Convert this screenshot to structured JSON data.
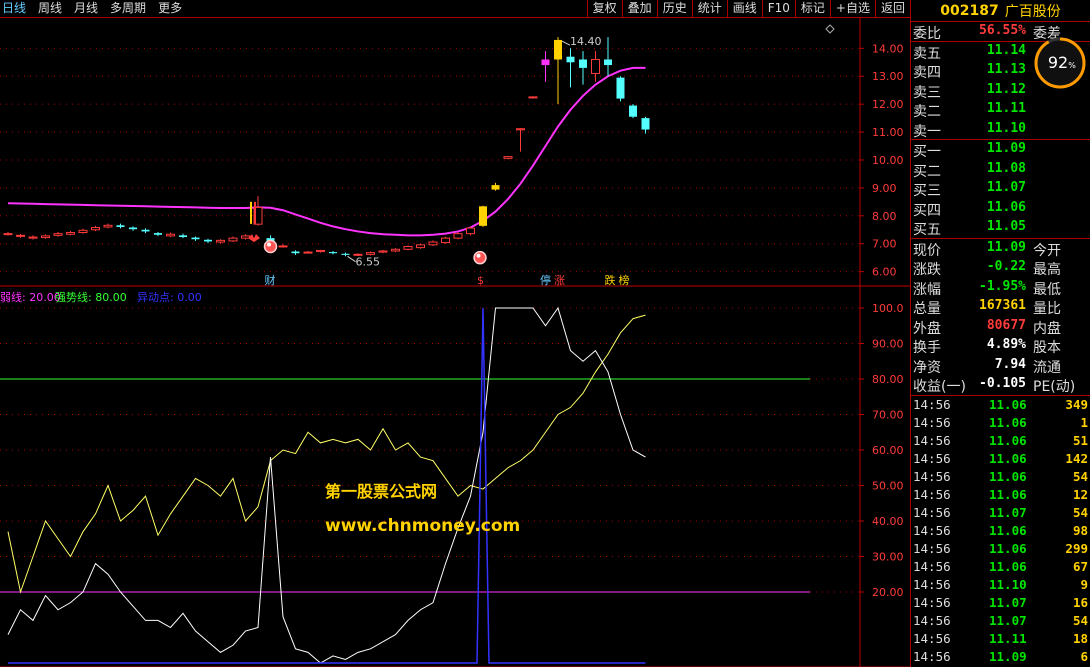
{
  "toolbar": {
    "periods": [
      {
        "label": "日线",
        "active": true
      },
      {
        "label": "周线",
        "active": false
      },
      {
        "label": "月线",
        "active": false
      },
      {
        "label": "多周期",
        "active": false
      },
      {
        "label": "更多",
        "active": false
      }
    ],
    "tools": [
      "复权",
      "叠加",
      "历史",
      "统计",
      "画线",
      "F10",
      "标记",
      "+自选",
      "返回"
    ]
  },
  "chart_data": [
    {
      "type": "candlestick",
      "y_ticks": [
        "14.00",
        "13.00",
        "12.00",
        "11.00",
        "10.00",
        "9.00",
        "8.00",
        "7.00",
        "6.00"
      ],
      "ylim": [
        5.7,
        14.8
      ],
      "high_label": "14.40",
      "low_label": "6.55",
      "markers": [
        "财",
        "$",
        "停",
        "涨",
        "跌",
        "榜"
      ],
      "candles": [
        {
          "o": 7.36,
          "c": 7.36,
          "h": 7.42,
          "l": 7.3
        },
        {
          "o": 7.3,
          "c": 7.3,
          "h": 7.35,
          "l": 7.22
        },
        {
          "o": 7.2,
          "c": 7.24,
          "h": 7.3,
          "l": 7.15
        },
        {
          "o": 7.22,
          "c": 7.28,
          "h": 7.33,
          "l": 7.18
        },
        {
          "o": 7.3,
          "c": 7.36,
          "h": 7.42,
          "l": 7.25
        },
        {
          "o": 7.34,
          "c": 7.4,
          "h": 7.46,
          "l": 7.3
        },
        {
          "o": 7.4,
          "c": 7.48,
          "h": 7.54,
          "l": 7.36
        },
        {
          "o": 7.5,
          "c": 7.58,
          "h": 7.64,
          "l": 7.45
        },
        {
          "o": 7.6,
          "c": 7.66,
          "h": 7.72,
          "l": 7.55
        },
        {
          "o": 7.66,
          "c": 7.6,
          "h": 7.72,
          "l": 7.55
        },
        {
          "o": 7.58,
          "c": 7.52,
          "h": 7.62,
          "l": 7.46
        },
        {
          "o": 7.5,
          "c": 7.44,
          "h": 7.55,
          "l": 7.38
        },
        {
          "o": 7.38,
          "c": 7.32,
          "h": 7.42,
          "l": 7.27
        },
        {
          "o": 7.28,
          "c": 7.34,
          "h": 7.4,
          "l": 7.24
        },
        {
          "o": 7.3,
          "c": 7.24,
          "h": 7.36,
          "l": 7.2
        },
        {
          "o": 7.22,
          "c": 7.16,
          "h": 7.26,
          "l": 7.1
        },
        {
          "o": 7.14,
          "c": 7.08,
          "h": 7.18,
          "l": 7.02
        },
        {
          "o": 7.06,
          "c": 7.12,
          "h": 7.16,
          "l": 7.0
        },
        {
          "o": 7.1,
          "c": 7.2,
          "h": 7.26,
          "l": 7.06
        },
        {
          "o": 7.2,
          "c": 7.28,
          "h": 7.34,
          "l": 7.15
        },
        {
          "o": 7.7,
          "c": 8.3,
          "h": 8.7,
          "l": 7.65
        },
        {
          "o": 7.2,
          "c": 7.1,
          "h": 7.3,
          "l": 6.8
        },
        {
          "o": 6.92,
          "c": 6.92,
          "h": 6.98,
          "l": 6.86
        },
        {
          "o": 6.72,
          "c": 6.66,
          "h": 6.76,
          "l": 6.6
        },
        {
          "o": 6.7,
          "c": 6.7,
          "h": 6.74,
          "l": 6.66
        },
        {
          "o": 6.72,
          "c": 6.76,
          "h": 6.78,
          "l": 6.68
        },
        {
          "o": 6.7,
          "c": 6.66,
          "h": 6.74,
          "l": 6.62
        },
        {
          "o": 6.64,
          "c": 6.6,
          "h": 6.68,
          "l": 6.55
        },
        {
          "o": 6.6,
          "c": 6.62,
          "h": 6.66,
          "l": 6.56
        },
        {
          "o": 6.62,
          "c": 6.68,
          "h": 6.72,
          "l": 6.58
        },
        {
          "o": 6.7,
          "c": 6.74,
          "h": 6.78,
          "l": 6.66
        },
        {
          "o": 6.74,
          "c": 6.8,
          "h": 6.84,
          "l": 6.7
        },
        {
          "o": 6.8,
          "c": 6.9,
          "h": 6.94,
          "l": 6.76
        },
        {
          "o": 6.86,
          "c": 6.96,
          "h": 7.0,
          "l": 6.82
        },
        {
          "o": 6.96,
          "c": 7.06,
          "h": 7.12,
          "l": 6.92
        },
        {
          "o": 7.04,
          "c": 7.2,
          "h": 7.24,
          "l": 7.0
        },
        {
          "o": 7.2,
          "c": 7.36,
          "h": 7.4,
          "l": 7.16
        },
        {
          "o": 7.36,
          "c": 7.56,
          "h": 7.6,
          "l": 7.3
        },
        {
          "o": 7.64,
          "c": 8.34,
          "h": 8.36,
          "l": 7.6
        },
        {
          "o": 8.94,
          "c": 9.1,
          "h": 9.18,
          "l": 8.9
        },
        {
          "o": 10.06,
          "c": 10.12,
          "h": 10.14,
          "l": 10.02
        },
        {
          "o": 11.08,
          "c": 11.12,
          "h": 11.14,
          "l": 10.3
        },
        {
          "o": 12.24,
          "c": 12.26,
          "h": 12.28,
          "l": 12.2
        },
        {
          "o": 13.4,
          "c": 13.6,
          "h": 13.9,
          "l": 12.8
        },
        {
          "o": 13.6,
          "c": 14.3,
          "h": 14.4,
          "l": 12.0
        },
        {
          "o": 13.7,
          "c": 13.5,
          "h": 14.0,
          "l": 12.6
        },
        {
          "o": 13.6,
          "c": 13.3,
          "h": 13.9,
          "l": 12.7
        },
        {
          "o": 13.1,
          "c": 13.6,
          "h": 13.9,
          "l": 12.8
        },
        {
          "o": 13.6,
          "c": 13.4,
          "h": 14.4,
          "l": 13.0
        },
        {
          "o": 12.95,
          "c": 12.2,
          "h": 13.0,
          "l": 12.1
        },
        {
          "o": 11.95,
          "c": 11.55,
          "h": 12.0,
          "l": 11.5
        },
        {
          "o": 11.5,
          "c": 11.09,
          "h": 11.55,
          "l": 10.95
        }
      ],
      "ma": [
        8.45,
        8.44,
        8.43,
        8.42,
        8.41,
        8.4,
        8.39,
        8.38,
        8.37,
        8.36,
        8.35,
        8.34,
        8.33,
        8.32,
        8.31,
        8.3,
        8.29,
        8.28,
        8.28,
        8.28,
        8.3,
        8.29,
        8.2,
        8.05,
        7.9,
        7.75,
        7.62,
        7.52,
        7.44,
        7.38,
        7.34,
        7.32,
        7.3,
        7.3,
        7.32,
        7.36,
        7.44,
        7.58,
        7.82,
        8.15,
        8.6,
        9.15,
        9.8,
        10.5,
        11.2,
        11.8,
        12.3,
        12.7,
        13.0,
        13.2,
        13.3,
        13.3
      ]
    },
    {
      "type": "line",
      "legend": [
        {
          "label": "弱线: 20.00",
          "color": "#ff33ff"
        },
        {
          "label": "强势线: 80.00",
          "color": "#33ff33"
        },
        {
          "label": "异动点: 0.00",
          "color": "#3333ff"
        }
      ],
      "y_ticks": [
        "100.0",
        "90.00",
        "80.00",
        "70.00",
        "60.00",
        "50.00",
        "40.00",
        "30.00",
        "20.00"
      ],
      "ylim": [
        0,
        100
      ],
      "reference_lines": [
        20,
        80
      ],
      "series": [
        {
          "values": [
            37,
            20,
            30,
            40,
            35,
            30,
            37,
            42,
            50,
            40,
            43,
            47,
            36,
            42,
            47,
            52,
            50,
            47,
            52,
            40,
            44,
            57,
            60,
            59,
            65,
            62,
            63,
            62,
            63,
            60,
            66,
            60,
            62,
            58,
            57,
            52,
            47,
            50,
            49,
            52,
            55,
            57,
            60,
            65,
            70,
            72,
            76,
            82,
            87,
            93,
            97,
            98
          ]
        },
        {
          "values": [
            8,
            15,
            12,
            19,
            15,
            17,
            20,
            28,
            25,
            20,
            16,
            12,
            12,
            10,
            14,
            9,
            6,
            3,
            5,
            9,
            10,
            58,
            13,
            4,
            3,
            0,
            2,
            1,
            3,
            4,
            6,
            8,
            12,
            15,
            17,
            28,
            38,
            47,
            65,
            100,
            100,
            100,
            100,
            95,
            100,
            88,
            85,
            88,
            82,
            70,
            60,
            58
          ]
        },
        {
          "values": [
            0,
            0,
            0,
            0,
            0,
            0,
            0,
            0,
            0,
            0,
            0,
            0,
            0,
            0,
            0,
            0,
            0,
            0,
            0,
            0,
            0,
            0,
            0,
            0,
            0,
            0,
            0,
            0,
            0,
            0,
            0,
            0,
            0,
            0,
            0,
            0,
            0,
            0,
            100,
            0,
            0,
            0,
            0,
            0,
            0,
            0,
            0,
            0,
            0,
            0,
            0,
            0
          ]
        }
      ]
    }
  ],
  "watermark": {
    "line1": "第一股票公式网",
    "line2": "www.chnmoney.com"
  },
  "quote": {
    "code": "002187",
    "name": "广百股份",
    "weibi": {
      "label": "委比",
      "value": "56.55%",
      "label2": "委差"
    },
    "gauge_value": "92",
    "gauge_unit": "%",
    "gauge_fraction": 0.92,
    "asks": [
      {
        "label": "卖五",
        "price": "11.14"
      },
      {
        "label": "卖四",
        "price": "11.13"
      },
      {
        "label": "卖三",
        "price": "11.12"
      },
      {
        "label": "卖二",
        "price": "11.11"
      },
      {
        "label": "卖一",
        "price": "11.10"
      }
    ],
    "bids": [
      {
        "label": "买一",
        "price": "11.09"
      },
      {
        "label": "买二",
        "price": "11.08"
      },
      {
        "label": "买三",
        "price": "11.07"
      },
      {
        "label": "买四",
        "price": "11.06"
      },
      {
        "label": "买五",
        "price": "11.05"
      }
    ],
    "stats": [
      {
        "label": "现价",
        "value": "11.09",
        "label2": "今开",
        "color": "green"
      },
      {
        "label": "涨跌",
        "value": "-0.22",
        "label2": "最高",
        "color": "green"
      },
      {
        "label": "涨幅",
        "value": "-1.95%",
        "label2": "最低",
        "color": "green"
      },
      {
        "label": "总量",
        "value": "167361",
        "label2": "量比",
        "color": "yellow"
      },
      {
        "label": "外盘",
        "value": "80677",
        "label2": "内盘",
        "color": "red"
      },
      {
        "label": "换手",
        "value": "4.89%",
        "label2": "股本",
        "color": "white"
      },
      {
        "label": "净资",
        "value": "7.94",
        "label2": "流通",
        "color": "white"
      },
      {
        "label": "收益(一)",
        "value": "-0.105",
        "label2": "PE(动)",
        "color": "white"
      }
    ],
    "ticks": [
      {
        "time": "14:56",
        "price": "11.06",
        "vol": "349"
      },
      {
        "time": "14:56",
        "price": "11.06",
        "vol": "1"
      },
      {
        "time": "14:56",
        "price": "11.06",
        "vol": "51"
      },
      {
        "time": "14:56",
        "price": "11.06",
        "vol": "142"
      },
      {
        "time": "14:56",
        "price": "11.06",
        "vol": "54"
      },
      {
        "time": "14:56",
        "price": "11.06",
        "vol": "12"
      },
      {
        "time": "14:56",
        "price": "11.07",
        "vol": "54"
      },
      {
        "time": "14:56",
        "price": "11.06",
        "vol": "98"
      },
      {
        "time": "14:56",
        "price": "11.06",
        "vol": "299"
      },
      {
        "time": "14:56",
        "price": "11.06",
        "vol": "67"
      },
      {
        "time": "14:56",
        "price": "11.10",
        "vol": "9"
      },
      {
        "time": "14:56",
        "price": "11.07",
        "vol": "16"
      },
      {
        "time": "14:56",
        "price": "11.07",
        "vol": "54"
      },
      {
        "time": "14:56",
        "price": "11.11",
        "vol": "18"
      },
      {
        "time": "14:56",
        "price": "11.09",
        "vol": "6"
      }
    ]
  }
}
